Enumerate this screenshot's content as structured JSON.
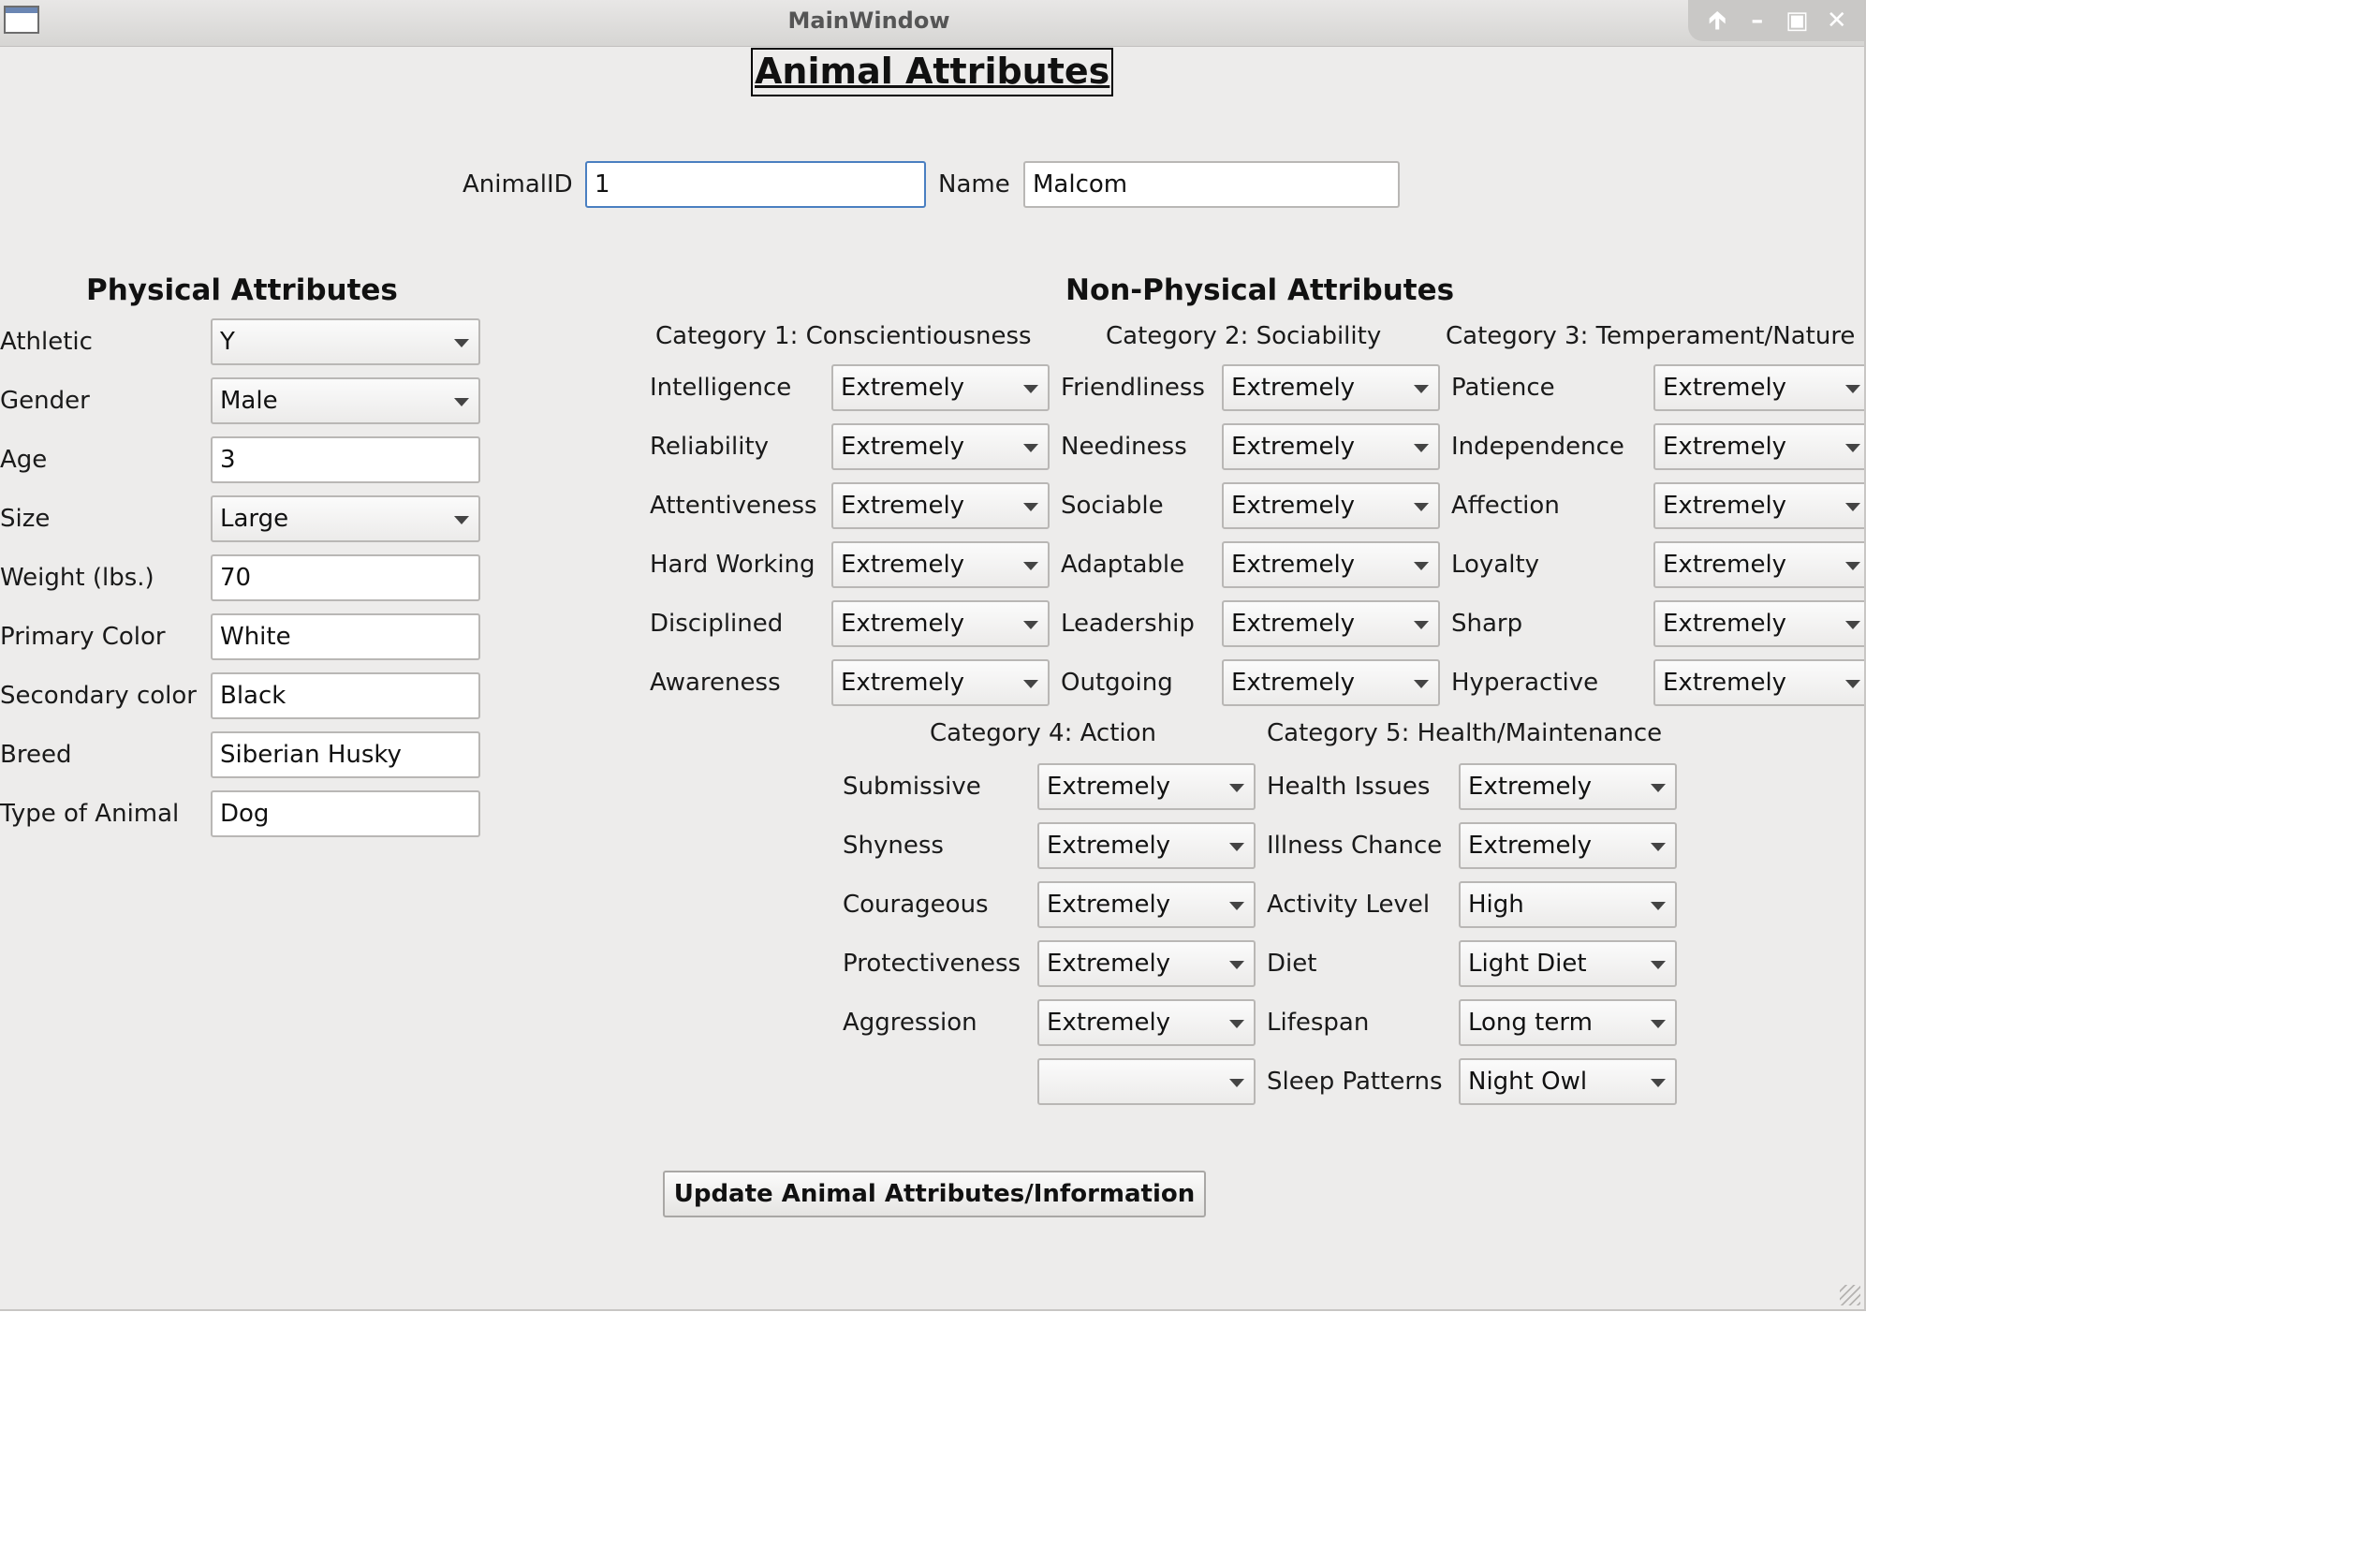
{
  "window": {
    "title": "MainWindow"
  },
  "heading": "Animal Attributes",
  "id_row": {
    "animal_id_label": "AnimalID",
    "animal_id_value": "1",
    "name_label": "Name",
    "name_value": "Malcom"
  },
  "physical": {
    "title": "Physical Attributes",
    "rows": [
      {
        "label": "Athletic",
        "value": "Y",
        "kind": "combo"
      },
      {
        "label": "Gender",
        "value": "Male",
        "kind": "combo"
      },
      {
        "label": "Age",
        "value": "3",
        "kind": "text"
      },
      {
        "label": "Size",
        "value": "Large",
        "kind": "combo"
      },
      {
        "label": "Weight (lbs.)",
        "value": "70",
        "kind": "text"
      },
      {
        "label": "Primary Color",
        "value": "White",
        "kind": "text"
      },
      {
        "label": "Secondary color",
        "value": "Black",
        "kind": "text"
      },
      {
        "label": "Breed",
        "value": "Siberian Husky",
        "kind": "text"
      },
      {
        "label": "Type of Animal",
        "value": "Dog",
        "kind": "text"
      }
    ]
  },
  "non_physical": {
    "title": "Non-Physical Attributes",
    "cat1": {
      "title": "Category 1: Conscientiousness",
      "rows": [
        {
          "label": "Intelligence",
          "value": "Extremely"
        },
        {
          "label": "Reliability",
          "value": "Extremely"
        },
        {
          "label": "Attentiveness",
          "value": "Extremely"
        },
        {
          "label": "Hard Working",
          "value": "Extremely"
        },
        {
          "label": "Disciplined",
          "value": "Extremely"
        },
        {
          "label": "Awareness",
          "value": "Extremely"
        }
      ]
    },
    "cat2": {
      "title": "Category 2: Sociability",
      "rows": [
        {
          "label": "Friendliness",
          "value": "Extremely"
        },
        {
          "label": "Neediness",
          "value": "Extremely"
        },
        {
          "label": "Sociable",
          "value": "Extremely"
        },
        {
          "label": "Adaptable",
          "value": "Extremely"
        },
        {
          "label": "Leadership",
          "value": "Extremely"
        },
        {
          "label": "Outgoing",
          "value": "Extremely"
        }
      ]
    },
    "cat3": {
      "title": "Category 3: Temperament/Nature",
      "rows": [
        {
          "label": "Patience",
          "value": "Extremely"
        },
        {
          "label": "Independence",
          "value": "Extremely"
        },
        {
          "label": "Affection",
          "value": "Extremely"
        },
        {
          "label": "Loyalty",
          "value": "Extremely"
        },
        {
          "label": "Sharp",
          "value": "Extremely"
        },
        {
          "label": "Hyperactive",
          "value": "Extremely"
        }
      ]
    },
    "cat4": {
      "title": "Category 4: Action",
      "rows": [
        {
          "label": "Submissive",
          "value": "Extremely"
        },
        {
          "label": "Shyness",
          "value": "Extremely"
        },
        {
          "label": "Courageous",
          "value": "Extremely"
        },
        {
          "label": "Protectiveness",
          "value": "Extremely"
        },
        {
          "label": "Aggression",
          "value": "Extremely"
        },
        {
          "label": "",
          "value": ""
        }
      ]
    },
    "cat5": {
      "title": "Category 5: Health/Maintenance",
      "rows": [
        {
          "label": "Health Issues",
          "value": "Extremely"
        },
        {
          "label": "Illness Chance",
          "value": "Extremely"
        },
        {
          "label": "Activity Level",
          "value": "High"
        },
        {
          "label": "Diet",
          "value": "Light Diet"
        },
        {
          "label": "Lifespan",
          "value": "Long term"
        },
        {
          "label": "Sleep Patterns",
          "value": "Night Owl"
        }
      ]
    }
  },
  "update_button": "Update Animal Attributes/Information",
  "icons": {
    "window_buttons": [
      "shade-up-icon",
      "minimize-icon",
      "maximize-icon",
      "close-icon"
    ]
  }
}
